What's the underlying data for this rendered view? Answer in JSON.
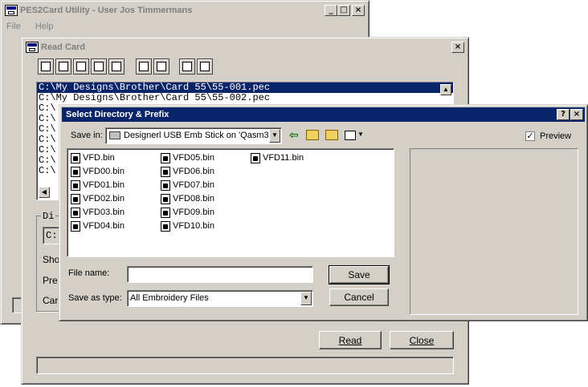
{
  "main_window": {
    "title": "PES2Card Utility - User Jos Timmermans",
    "menu": [
      "File",
      "Help"
    ]
  },
  "read_card": {
    "title": "Read Card",
    "files": [
      "C:\\My Designs\\Brother\\Card 55\\55-001.pec",
      "C:\\My Designs\\Brother\\Card 55\\55-002.pec",
      "C:\\",
      "C:\\",
      "C:\\",
      "C:\\",
      "C:\\",
      "C:\\",
      "C:\\"
    ],
    "group_label": "Di",
    "dir_value": "C:",
    "partial_labels": [
      "Sho",
      "Pre",
      "Car"
    ],
    "read_label": "Read",
    "close_label": "Close"
  },
  "dialog": {
    "title": "Select Directory & Prefix",
    "help_btn": "?",
    "close_btn": "×",
    "save_in_label": "Save in:",
    "save_in_value": "Designerl USB Emb Stick on 'Qasm3(",
    "preview_label": "Preview",
    "preview_checked": true,
    "files_col1": [
      "VFD.bin",
      "VFD00.bin",
      "VFD01.bin",
      "VFD02.bin",
      "VFD03.bin",
      "VFD04.bin"
    ],
    "files_col2": [
      "VFD05.bin",
      "VFD06.bin",
      "VFD07.bin",
      "VFD08.bin",
      "VFD09.bin",
      "VFD10.bin"
    ],
    "files_col3": [
      "VFD11.bin"
    ],
    "file_name_label": "File name:",
    "file_name_value": "",
    "save_as_label": "Save as type:",
    "save_as_value": "All Embroidery Files",
    "save_btn": "Save",
    "cancel_btn": "Cancel"
  }
}
